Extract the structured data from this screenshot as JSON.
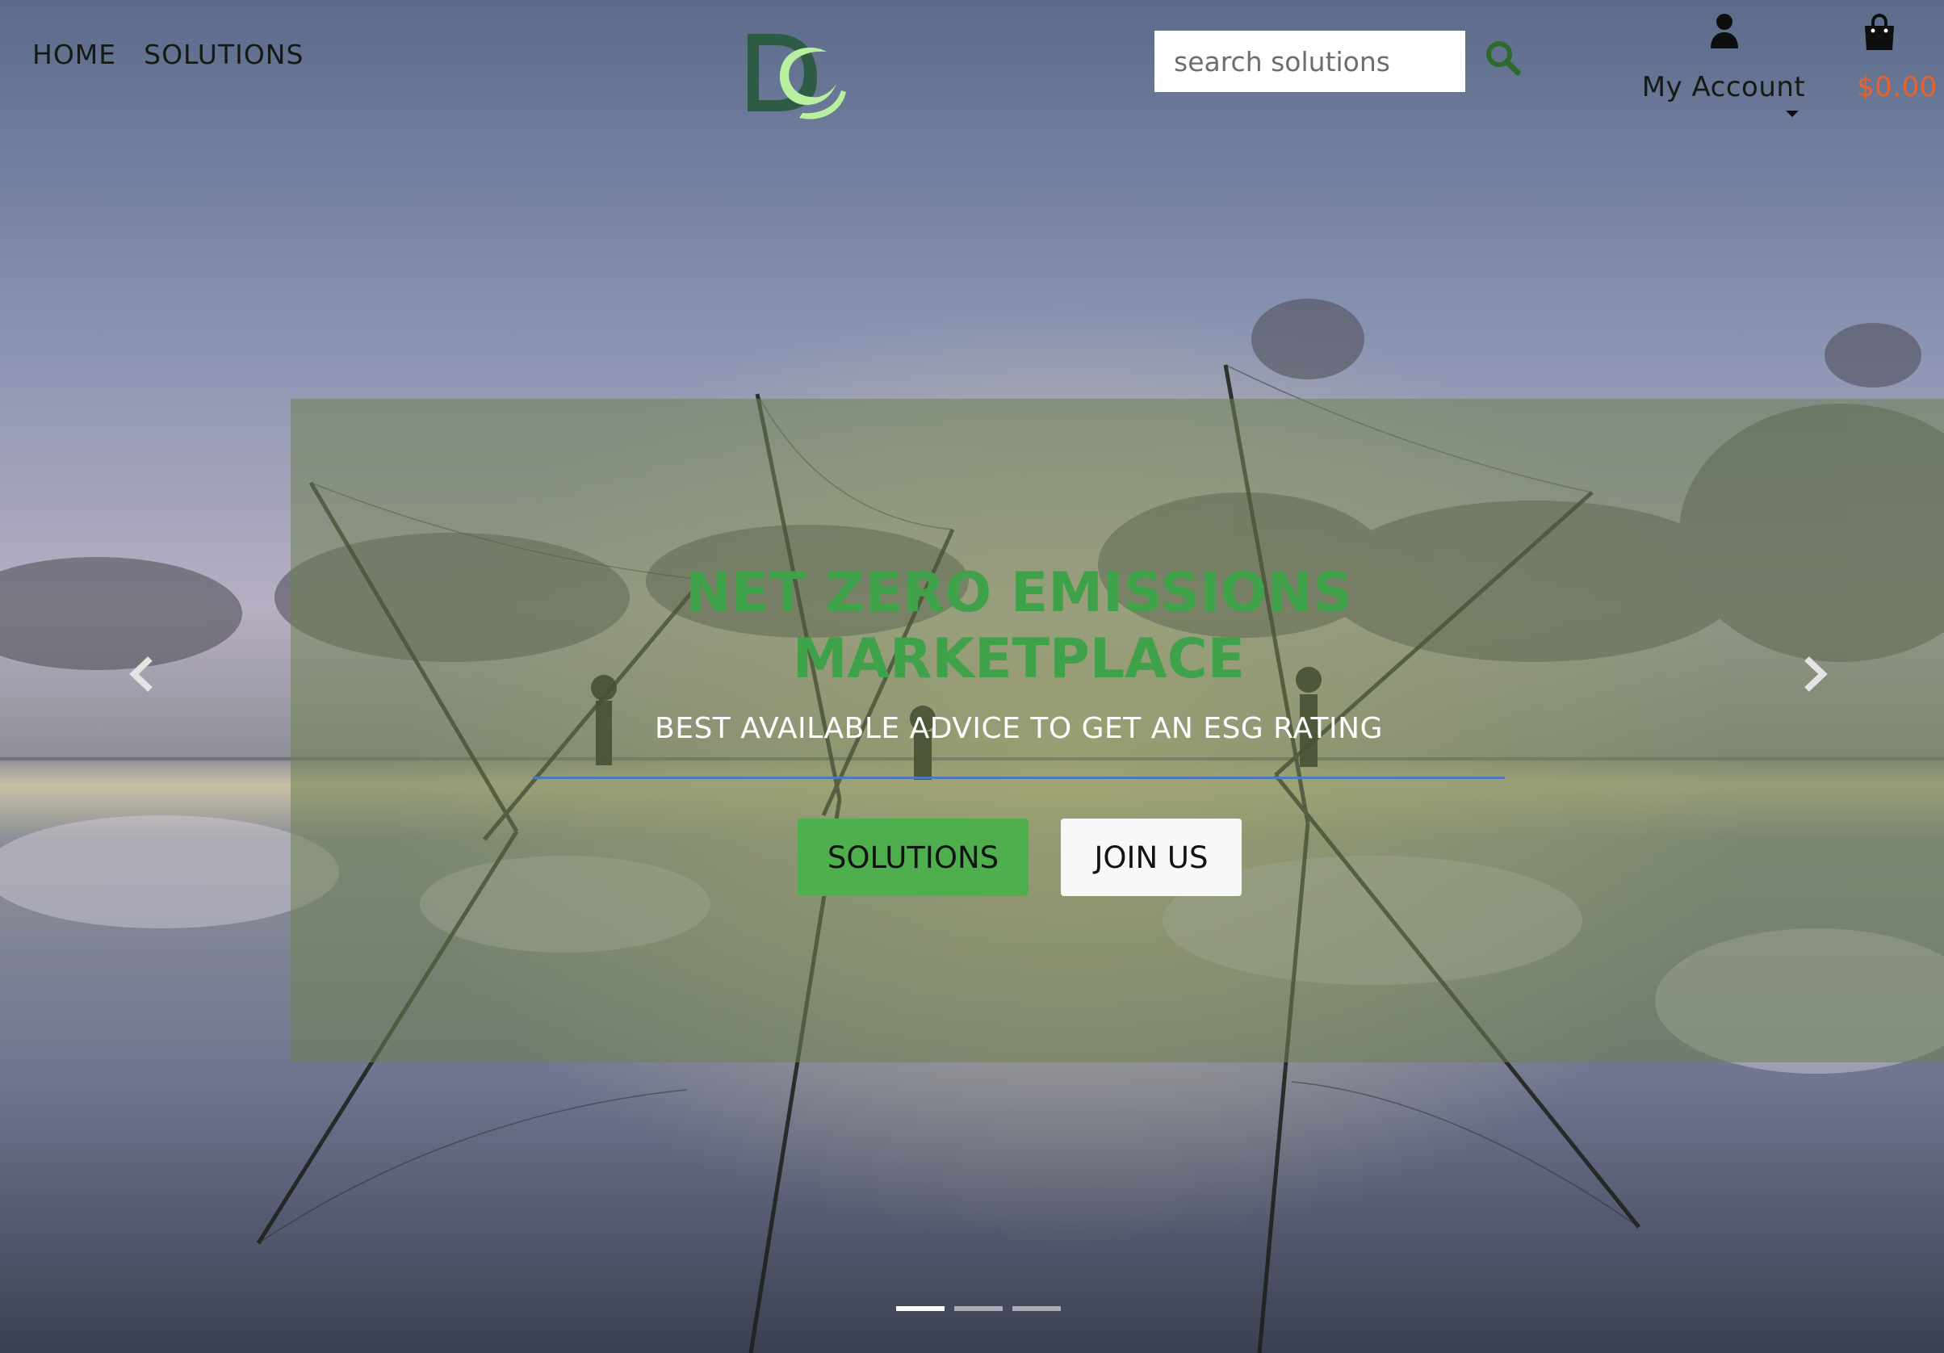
{
  "nav": {
    "items": [
      {
        "label": "HOME"
      },
      {
        "label": "SOLUTIONS"
      }
    ]
  },
  "search": {
    "placeholder": "search solutions"
  },
  "account": {
    "label": "My Account"
  },
  "cart": {
    "total": "$0.00"
  },
  "hero": {
    "title_line1": "NET ZERO EMISSIONS",
    "title_line2": "MARKETPLACE",
    "subtitle": "BEST AVAILABLE ADVICE TO GET AN ESG RATING",
    "primary_button": "SOLUTIONS",
    "secondary_button": "JOIN US"
  },
  "carousel": {
    "slide_count": 3,
    "active_index": 0
  },
  "colors": {
    "brand_green": "#3fa24a",
    "button_green": "#4fae4e",
    "cart_price": "#e8622c",
    "logo_dark": "#2e5b44",
    "logo_light": "#b9f0a0"
  },
  "icons": {
    "search": "search-icon",
    "account": "user-icon",
    "cart": "shopping-bag-icon",
    "prev": "chevron-left-icon",
    "next": "chevron-right-icon"
  }
}
